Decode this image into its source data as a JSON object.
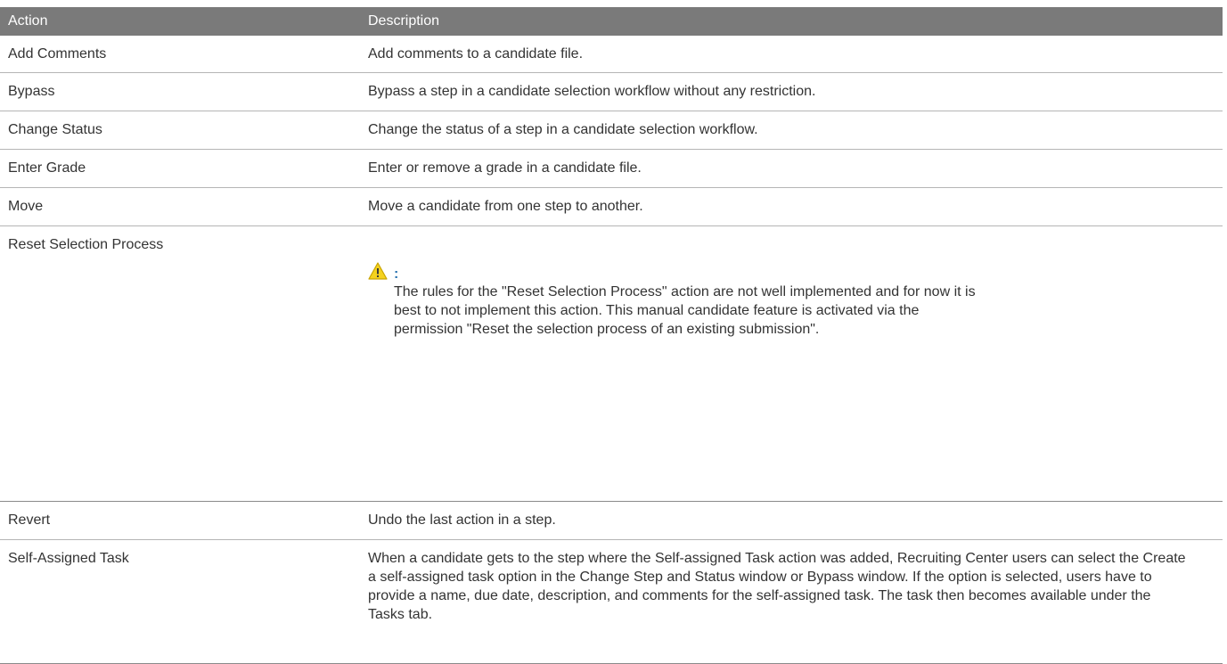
{
  "table": {
    "headers": [
      "Action",
      "Description"
    ],
    "rows": [
      {
        "action": "Add Comments",
        "description": "Add comments to a candidate file."
      },
      {
        "action": "Bypass",
        "description": "Bypass a step in a candidate selection workflow without any restriction."
      },
      {
        "action": "Change Status",
        "description": "Change the status of a step in a candidate selection workflow."
      },
      {
        "action": "Enter Grade",
        "description": "Enter or remove a grade in a candidate file."
      },
      {
        "action": "Move",
        "description": "Move a candidate from one step to another."
      },
      {
        "action": "Reset Selection Process",
        "description": ""
      },
      {
        "action": "Revert",
        "description": "Undo the last action in a step."
      },
      {
        "action": "Self-Assigned Task",
        "description": "When a candidate gets to the step where the Self-assigned Task action was added, Recruiting Center users can select the Create a self-assigned task option in the Change Step and Status window or Bypass window. If the option is selected, users have to provide a name, due date, description, and comments for the self-assigned task. The task then becomes available under the Tasks tab."
      }
    ]
  },
  "note": {
    "icon": "warning-icon",
    "label": ":",
    "text": "The rules for the \"Reset Selection Process\" action are not well implemented and for now it is best to not implement this action. This manual candidate feature is activated via the permission \"Reset the selection process of an existing submission\"."
  },
  "colors": {
    "header_bg": "#7a7a7a",
    "note_label": "#2a73b0",
    "warning_fill": "#f5d21f"
  }
}
